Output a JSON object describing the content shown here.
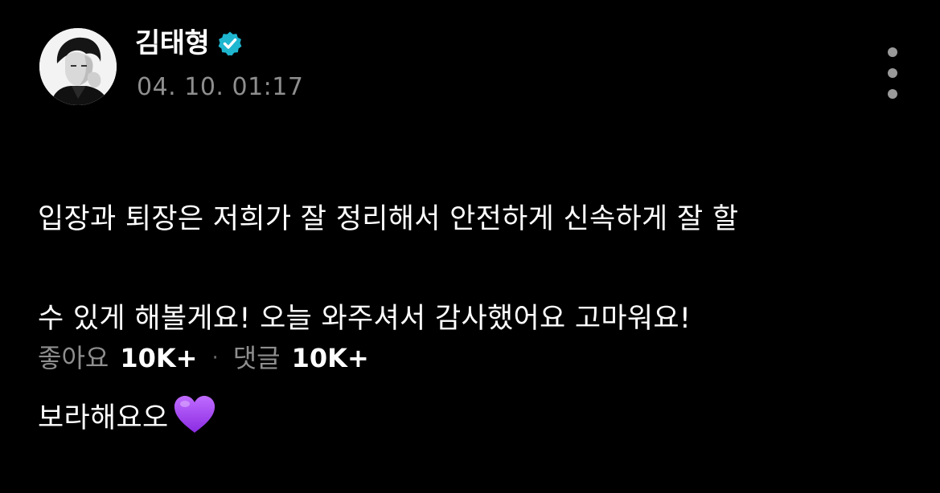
{
  "post": {
    "username": "김태형",
    "timestamp": "04. 10. 01:17",
    "body_line_1": "입장과 퇴장은 저희가 잘 정리해서 안전하게 신속하게 잘 할",
    "body_line_2": "수 있게 해볼게요! 오늘 와주셔서 감사했어요 고마워요!",
    "body_line_3": "보라해요오",
    "emoji": "purple-heart-icon"
  },
  "stats": {
    "likes_label": "좋아요",
    "likes_count": "10K+",
    "separator": "·",
    "comments_label": "댓글",
    "comments_count": "10K+"
  },
  "colors": {
    "background": "#000000",
    "text": "#ffffff",
    "muted": "#8e8e8e",
    "verified": "#1fb6d0",
    "heart": "#a64cf0"
  },
  "icons": {
    "verified": "verified-badge-icon",
    "more": "more-vertical-icon",
    "avatar": "profile-avatar"
  }
}
